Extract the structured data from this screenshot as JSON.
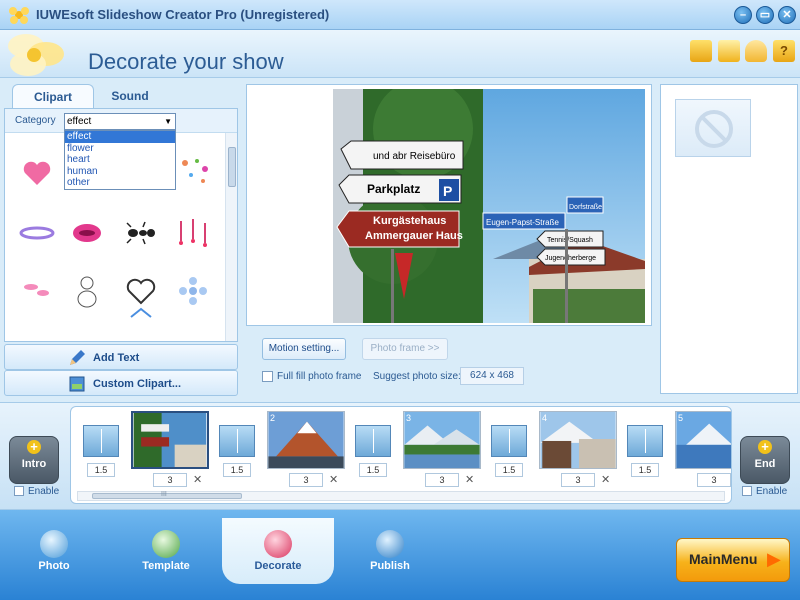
{
  "window": {
    "title": "IUWEsoft Slideshow Creator Pro (Unregistered)",
    "controls": [
      "minimize",
      "restore",
      "close"
    ]
  },
  "header": {
    "page_title": "Decorate your show",
    "icons": [
      "folder-icon",
      "save-icon",
      "user-icon",
      "help-icon"
    ]
  },
  "left_panel": {
    "tabs": [
      {
        "label": "Clipart",
        "active": true
      },
      {
        "label": "Sound",
        "active": false
      }
    ],
    "category_label": "Category",
    "category_value": "effect",
    "category_options": [
      "effect",
      "flower",
      "heart",
      "human",
      "other"
    ],
    "add_text_label": "Add Text",
    "custom_clipart_label": "Custom Clipart..."
  },
  "preview": {
    "motion_button": "Motion setting...",
    "photo_frame_button": "Photo frame >>",
    "full_fill_label": "Full fill photo frame",
    "full_fill_checked": false,
    "suggest_label": "Suggest photo size:",
    "suggest_value": "624 x 468",
    "photo_signs": [
      "und abr Reisebüro",
      "Parkplatz",
      "P",
      "Kurgästehaus",
      "Ammergauer Haus",
      "Eugen-Papst-Straße",
      "Dorfstraße",
      "Tennis/Squash",
      "Jugendherberge"
    ]
  },
  "timeline": {
    "intro_label": "Intro",
    "end_label": "End",
    "enable_label": "Enable",
    "slides": [
      {
        "index": "",
        "duration": "3",
        "selected": true
      },
      {
        "index": "2",
        "duration": "3",
        "selected": false
      },
      {
        "index": "3",
        "duration": "3",
        "selected": false
      },
      {
        "index": "4",
        "duration": "3",
        "selected": false
      },
      {
        "index": "5",
        "duration": "3",
        "selected": false
      }
    ],
    "transitions": [
      "1.5",
      "1.5",
      "1.5",
      "1.5",
      "1.5"
    ],
    "scroll_thumb_label": "III"
  },
  "nav": {
    "items": [
      {
        "label": "Photo"
      },
      {
        "label": "Template"
      },
      {
        "label": "Decorate",
        "active": true
      },
      {
        "label": "Publish"
      }
    ],
    "main_menu": "MainMenu"
  }
}
